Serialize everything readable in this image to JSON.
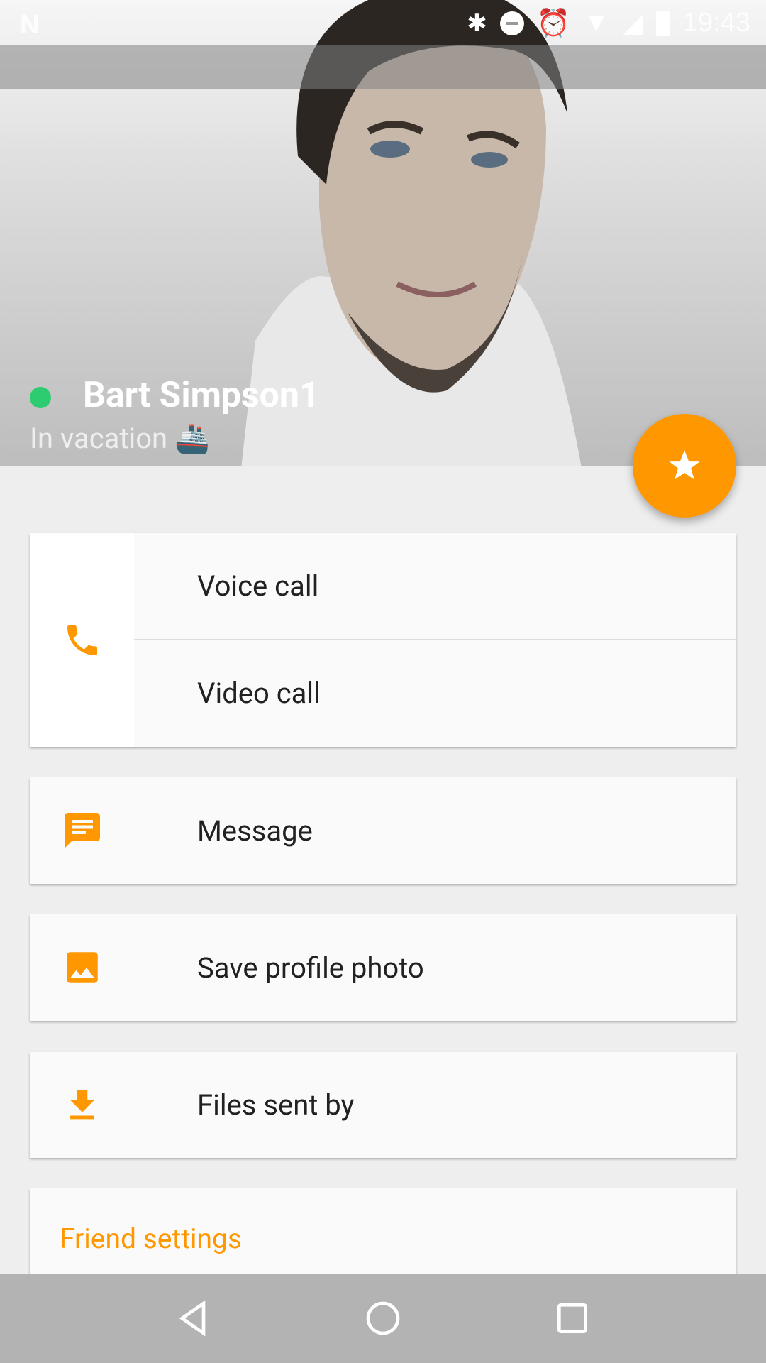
{
  "status_bar": {
    "time": "19:43",
    "icons": [
      "n-logo-icon",
      "bluetooth-icon",
      "do-not-disturb-icon",
      "alarm-icon",
      "wifi-icon",
      "signal-icon",
      "battery-icon"
    ]
  },
  "profile": {
    "name": "Bart Simpson1",
    "status_text": "In vacation",
    "status_emoji": "🚢",
    "online_color": "#2ecc71"
  },
  "fab": {
    "icon": "star-icon",
    "color": "#ff9800"
  },
  "actions": {
    "call_icon": "phone-icon",
    "voice_call": "Voice call",
    "video_call": "Video call",
    "message": "Message",
    "save_photo": "Save profile photo",
    "files_sent": "Files sent by"
  },
  "friend_settings": {
    "title": "Friend settings"
  },
  "accent": "#ff9800",
  "nav": {
    "back": "back-icon",
    "home": "home-icon",
    "recents": "recents-icon"
  }
}
